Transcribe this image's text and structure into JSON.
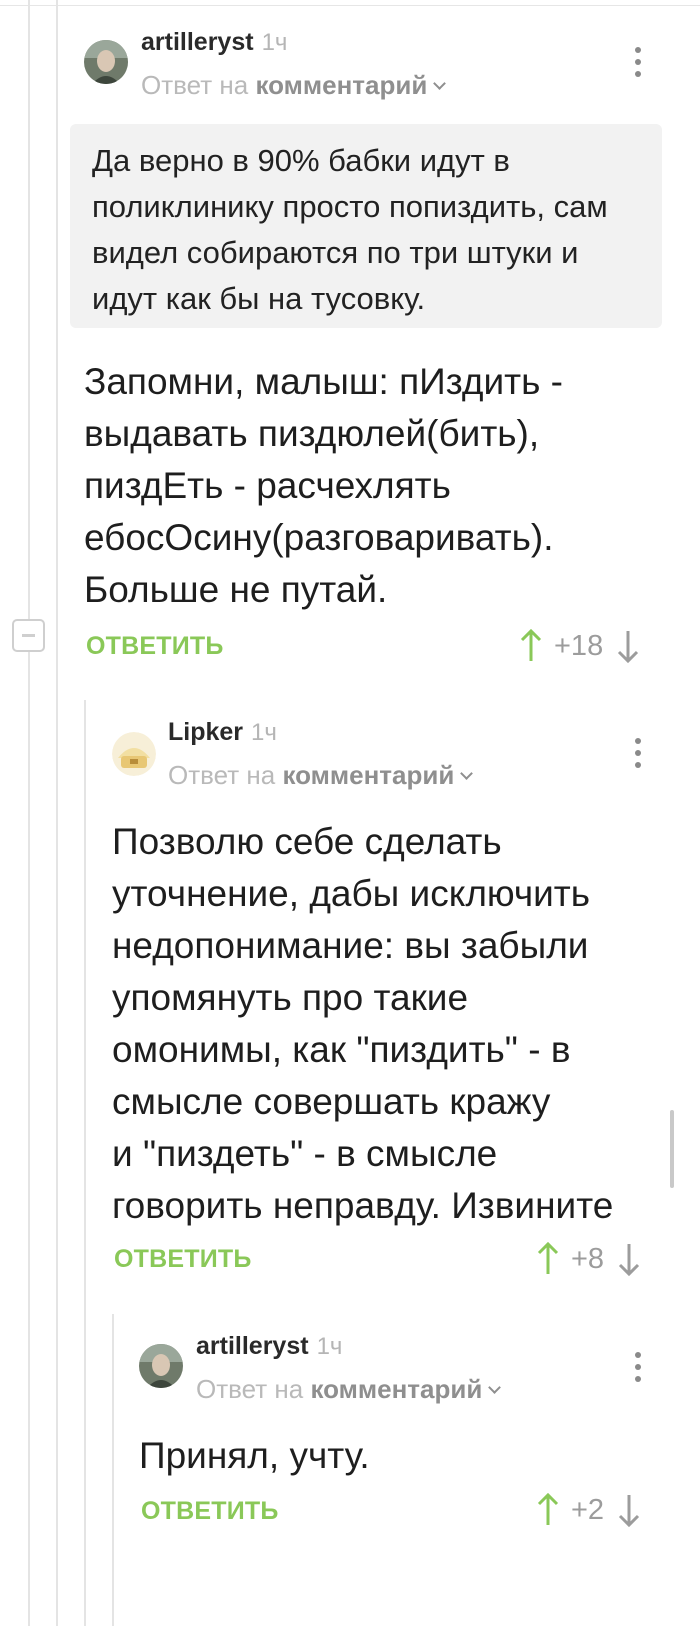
{
  "comments": [
    {
      "author": "artilleryst",
      "time": "1ч",
      "reply_prefix": "Ответ на",
      "reply_target": "комментарий",
      "quote": "Да верно в 90% бабки идут в поликлинику просто попиздить, сам видел собираются по три штуки и идут как бы на тусовку.",
      "text_lines": [
        "Запомни, малыш: пИздить -",
        "выдавать пиздюлей(бить),",
        "пиздЕть - расчехлять",
        "ебосОсину(разговаривать).",
        "Больше не путай."
      ],
      "reply_label": "ОТВЕТИТЬ",
      "score": "+18"
    },
    {
      "author": "Lipker",
      "time": "1ч",
      "reply_prefix": "Ответ на",
      "reply_target": "комментарий",
      "text_lines": [
        "Позволю себе сделать",
        "уточнение, дабы исключить",
        "недопонимание: вы забыли",
        "упомянуть про такие",
        "омонимы, как \"пиздить\" - в",
        "смысле совершать кражу",
        "и \"пиздеть\" - в смысле",
        "говорить неправду. Извините"
      ],
      "reply_label": "ОТВЕТИТЬ",
      "score": "+8"
    },
    {
      "author": "artilleryst",
      "time": "1ч",
      "reply_prefix": "Ответ на",
      "reply_target": "комментарий",
      "text_lines": [
        "Принял, учту."
      ],
      "reply_label": "ОТВЕТИТЬ",
      "score": "+2"
    }
  ],
  "colors": {
    "accent_green": "#8ac858",
    "muted_gray": "#9c9c9c",
    "quote_bg": "#f2f2f2"
  }
}
